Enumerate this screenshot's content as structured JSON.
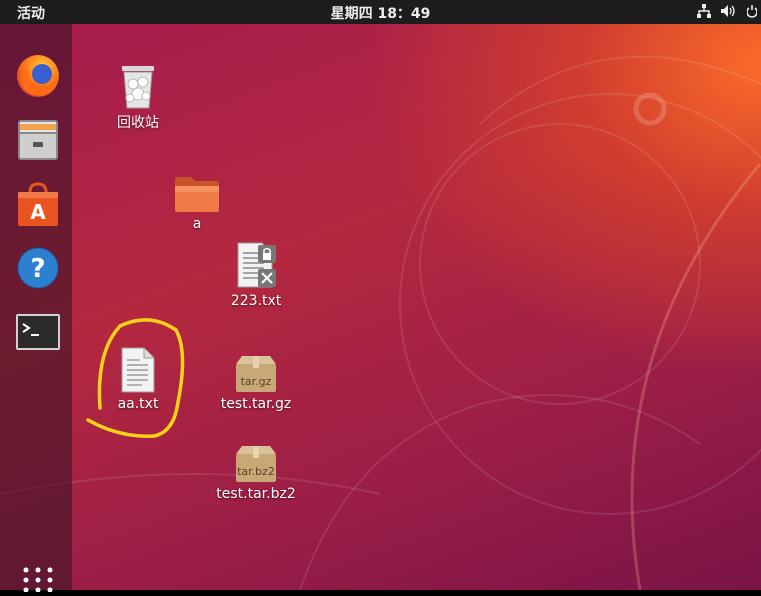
{
  "topbar": {
    "activities": "活动",
    "clock": "星期四 18：49",
    "icons": [
      "network-icon",
      "volume-icon",
      "power-icon"
    ]
  },
  "dock": {
    "items": [
      {
        "name": "firefox",
        "icon": "firefox-icon"
      },
      {
        "name": "files",
        "icon": "file-cabinet-icon"
      },
      {
        "name": "software",
        "icon": "shopping-bag-icon"
      },
      {
        "name": "help",
        "icon": "help-icon"
      },
      {
        "name": "terminal",
        "icon": "terminal-icon"
      }
    ],
    "apps_button_icon": "grid-icon"
  },
  "desktop": {
    "icons": [
      {
        "label": "回收站",
        "icon": "trash-icon"
      },
      {
        "label": "a",
        "icon": "folder-icon"
      },
      {
        "label": "223.txt",
        "icon": "locked-text-file-icon"
      },
      {
        "label": "aa.txt",
        "icon": "text-file-icon"
      },
      {
        "label": "test.tar.gz",
        "icon": "archive-icon",
        "badge": "tar.gz"
      },
      {
        "label": "test.tar.bz2",
        "icon": "archive-icon",
        "badge": "tar.bz2"
      }
    ]
  },
  "colors": {
    "accent_orange": "#e95420",
    "background": "#a61c4e",
    "annotation": "#ffd21a"
  }
}
